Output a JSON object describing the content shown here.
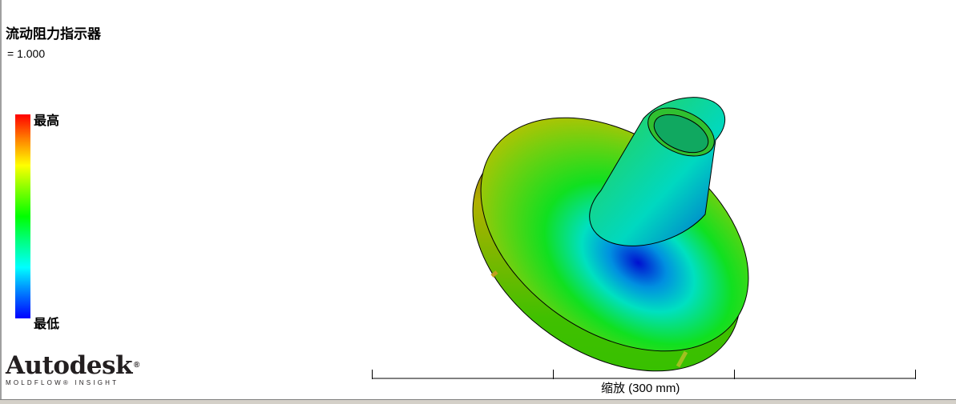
{
  "plot": {
    "title": "流动阻力指示器",
    "value_label": "= 1.000"
  },
  "legend": {
    "max_label": "最高",
    "min_label": "最低",
    "colors": [
      "#ff0000",
      "#ffff00",
      "#00ff00",
      "#00ffff",
      "#0000ff"
    ]
  },
  "logo": {
    "brand": "Autodesk",
    "registered": "®",
    "product": "MOLDFLOW® INSIGHT"
  },
  "scale": {
    "label": "缩放 (300 mm)"
  }
}
